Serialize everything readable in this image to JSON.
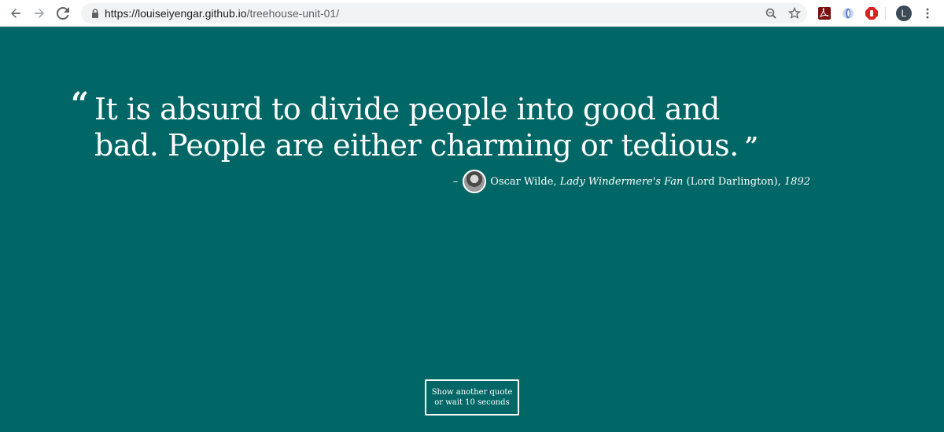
{
  "browser": {
    "url_host": "https://louiseiyengar.github.io",
    "url_path": "/treehouse-unit-01/",
    "avatar_letter": "L",
    "icons": [
      "back-icon",
      "forward-icon",
      "reload-icon",
      "lock-icon",
      "zoom-icon",
      "bookmark-star-icon",
      "pdf-extension-icon",
      "extension-icon",
      "stop-extension-icon",
      "menu-icon"
    ]
  },
  "quote": {
    "open_mark": "“",
    "text": "It is absurd to divide people into good and bad. People are either charming or tedious.",
    "close_mark": "”",
    "dash": "–",
    "author": "Oscar Wilde,",
    "source": "Lady Windermere's Fan",
    "character": "(Lord Darlington),",
    "year": "1892"
  },
  "button": {
    "line1": "Show another quote",
    "line2": "or wait 10 seconds"
  },
  "colors": {
    "background": "#016766",
    "text": "#ffffff"
  }
}
